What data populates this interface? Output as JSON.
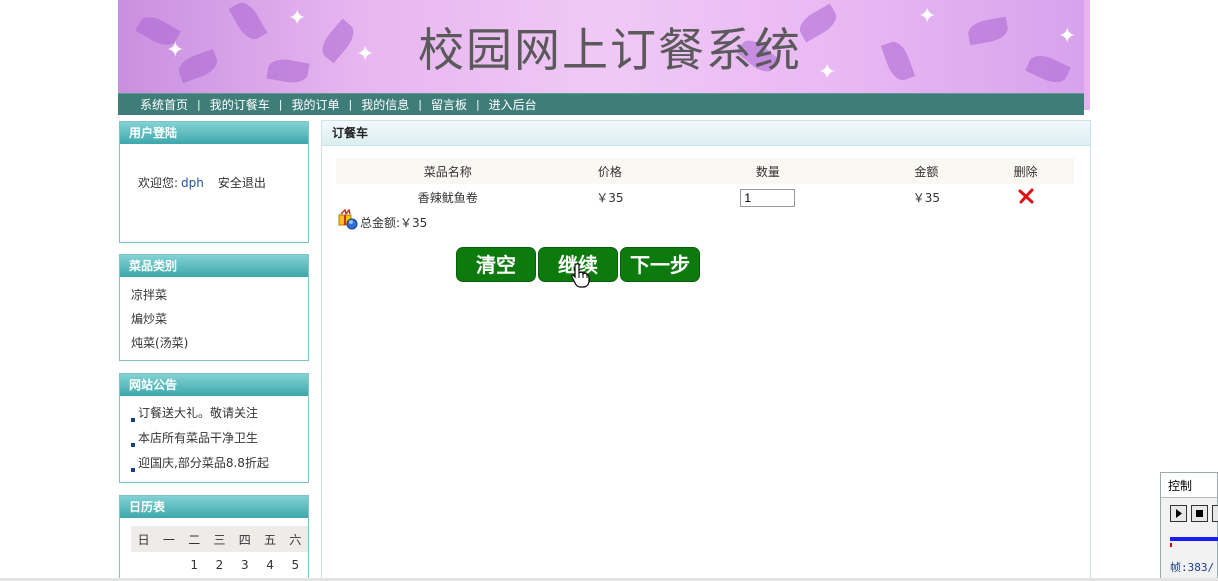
{
  "site": {
    "title": "校园网上订餐系统"
  },
  "nav": [
    {
      "label": "系统首页"
    },
    {
      "label": "我的订餐车"
    },
    {
      "label": "我的订单"
    },
    {
      "label": "我的信息"
    },
    {
      "label": "留言板"
    },
    {
      "label": "进入后台"
    }
  ],
  "nav_separator": "|",
  "login": {
    "title": "用户登陆",
    "welcome": "欢迎您:",
    "username": "dph",
    "logout": "安全退出"
  },
  "categories": {
    "title": "菜品类别",
    "items": [
      "凉拌菜",
      "煸炒菜",
      "炖菜(汤菜)"
    ]
  },
  "notices": {
    "title": "网站公告",
    "items": [
      "订餐送大礼。敬请关注",
      "本店所有菜品干净卫生",
      "迎国庆,部分菜品8.8折起"
    ]
  },
  "calendar": {
    "title": "日历表",
    "weekdays": [
      "日",
      "一",
      "二",
      "三",
      "四",
      "五",
      "六"
    ],
    "first_row": [
      "",
      "",
      "1",
      "2",
      "3",
      "4",
      "5"
    ]
  },
  "cart": {
    "title": "订餐车",
    "columns": [
      "菜品名称",
      "价格",
      "数量",
      "金额",
      "删除"
    ],
    "rows": [
      {
        "name": "香辣鱿鱼卷",
        "price": "￥35",
        "quantity": "1",
        "amount": "￥35"
      }
    ],
    "total_label": "总金额:",
    "total_value": "￥35",
    "buttons": {
      "clear": "清空",
      "continue": "继续",
      "next": "下一步"
    }
  },
  "control_panel": {
    "title": "控制",
    "frame_label": "帧:383/"
  },
  "colors": {
    "nav_bg": "#3f7d79",
    "box_header": "#3da7ab",
    "button_green": "#0d7a0d",
    "delete_red": "#e01010"
  }
}
